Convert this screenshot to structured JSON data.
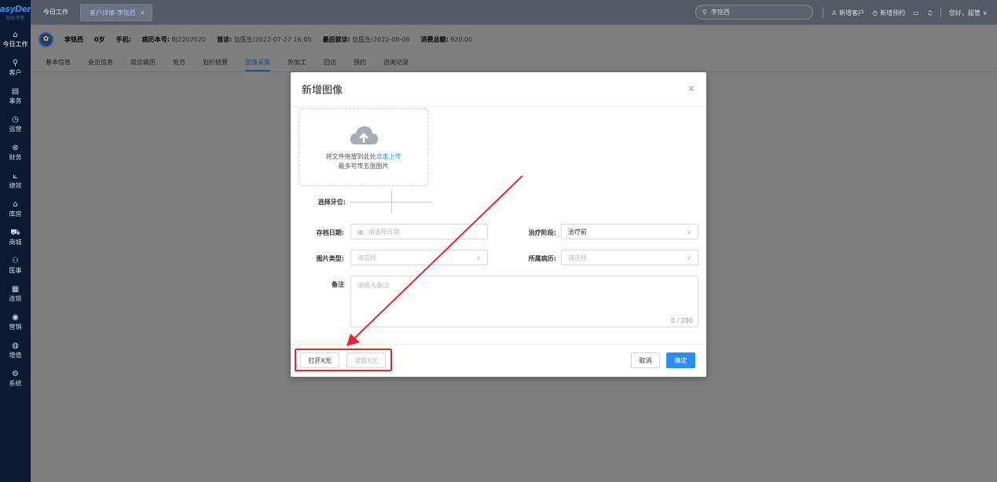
{
  "brand": {
    "name": "EasyDent",
    "sub": "轻松牙医"
  },
  "sidebar": {
    "items": [
      {
        "label": "今日工作",
        "icon": "home-icon"
      },
      {
        "label": "客户",
        "icon": "user-icon"
      },
      {
        "label": "事务",
        "icon": "task-icon"
      },
      {
        "label": "运营",
        "icon": "clock-icon"
      },
      {
        "label": "财务",
        "icon": "money-icon"
      },
      {
        "label": "绩效",
        "icon": "chart-icon"
      },
      {
        "label": "库房",
        "icon": "warehouse-icon"
      },
      {
        "label": "商城",
        "icon": "cart-icon"
      },
      {
        "label": "医事",
        "icon": "team-icon"
      },
      {
        "label": "连锁",
        "icon": "chain-icon"
      },
      {
        "label": "营销",
        "icon": "marketing-icon"
      },
      {
        "label": "增值",
        "icon": "addon-icon"
      },
      {
        "label": "系统",
        "icon": "gear-icon"
      }
    ]
  },
  "topbar": {
    "home_tab": "今日工作",
    "active_tab": "客户详情-李铭西",
    "search_value": "李铭西",
    "actions": [
      "新增客户",
      "新增预约"
    ],
    "greeting": "您好，超管"
  },
  "patient": {
    "name": "李铭西",
    "age": "0岁",
    "phone_label": "手机:",
    "record_label": "病历本号:",
    "record_value": "BJ2207020",
    "first_label": "首诊:",
    "first_value": "伍医生/2022-07-27 16:05",
    "last_label": "最后就诊:",
    "last_value": "伍医生/2022-08-06",
    "total_label": "消费总额:",
    "total_value": "920.00"
  },
  "subtabs": [
    "基本信息",
    "会员信息",
    "就诊病历",
    "处方",
    "划价结算",
    "图像采集",
    "外加工",
    "回访",
    "预约",
    "咨询记录"
  ],
  "modal": {
    "title": "新增图像",
    "upload_hint_prefix": "将文件拖放到此处",
    "upload_link": "点击上传",
    "upload_limit": "最多可传五张图片",
    "tooth_label": "选择牙位:",
    "date_label": "存档日期:",
    "date_placeholder": "请选择日期",
    "stage_label": "治疗阶段:",
    "stage_value": "治疗前",
    "type_label": "图片类型:",
    "type_placeholder": "请选择",
    "record_label": "所属病历:",
    "record_placeholder": "请选择",
    "note_label": "备注",
    "note_placeholder": "请输入备注",
    "note_count": "0 / 200",
    "open_xray": "打开X光",
    "read_xray": "读取X光",
    "cancel": "取消",
    "confirm": "确定"
  },
  "colors": {
    "accent": "#2d8cf0",
    "highlight": "#e8262c",
    "sidebar": "#0b1a33"
  }
}
